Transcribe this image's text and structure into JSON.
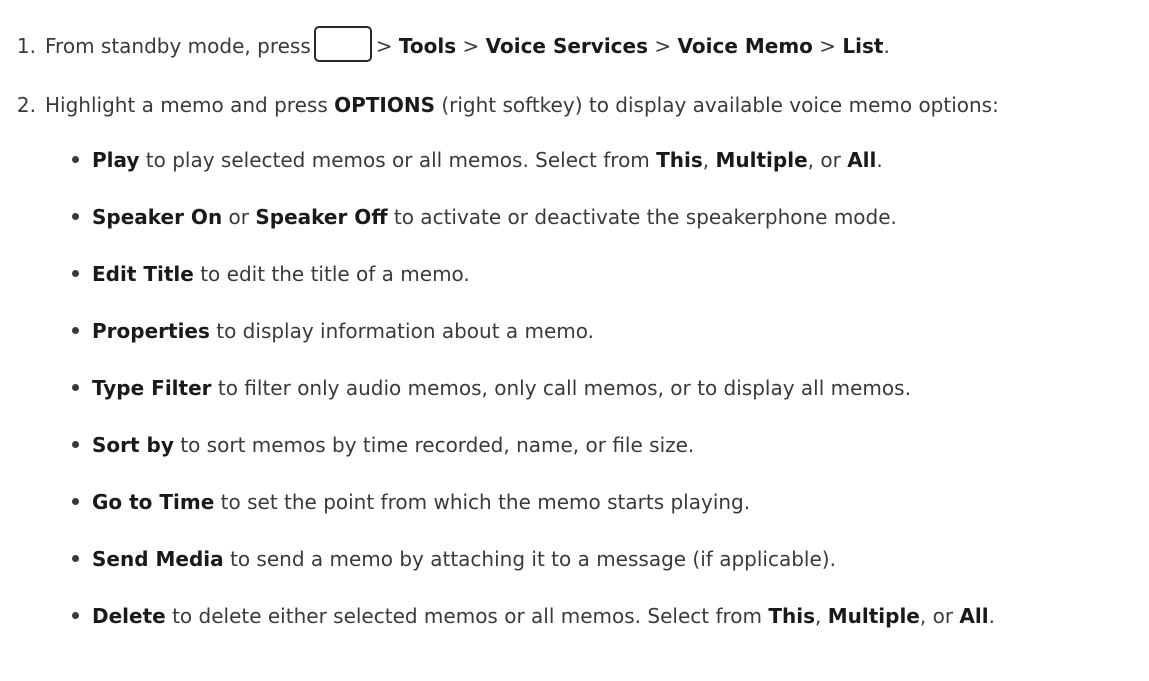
{
  "steps": [
    {
      "number": "1.",
      "text_pre": "From standby mode, press",
      "menu_key_icon": "menu-key-icon",
      "path_sep": ">",
      "path": [
        "Tools",
        "Voice Services",
        "Voice Memo",
        "List"
      ],
      "text_post": "."
    },
    {
      "number": "2.",
      "text_pre": "Highlight a memo and press",
      "key": "OPTIONS",
      "text_post": "(right softkey) to display available voice memo options:"
    }
  ],
  "options": [
    {
      "name": "Play",
      "desc": "to play selected memos or all memos. Select from",
      "choices": [
        "This",
        "Multiple",
        "All"
      ],
      "or": "or"
    },
    {
      "name": "Speaker On",
      "or": "or",
      "name2": "Speaker Off",
      "desc": "to activate or deactivate the speakerphone mode."
    },
    {
      "name": "Edit Title",
      "desc": "to edit the title of a memo."
    },
    {
      "name": "Properties",
      "desc": "to display information about a memo."
    },
    {
      "name": "Type Filter",
      "desc": "to filter only audio memos, only call memos, or to display all memos."
    },
    {
      "name": "Sort by",
      "desc": "to sort memos by time recorded, name, or file size."
    },
    {
      "name": "Go to Time",
      "desc": "to set the point from which the memo starts playing."
    },
    {
      "name": "Send Media",
      "desc": "to send a memo by attaching it to a message (if applicable)."
    },
    {
      "name": "Delete",
      "desc": "to delete either selected memos or all memos. Select from",
      "choices": [
        "This",
        "Multiple",
        "All"
      ],
      "or": "or"
    }
  ]
}
